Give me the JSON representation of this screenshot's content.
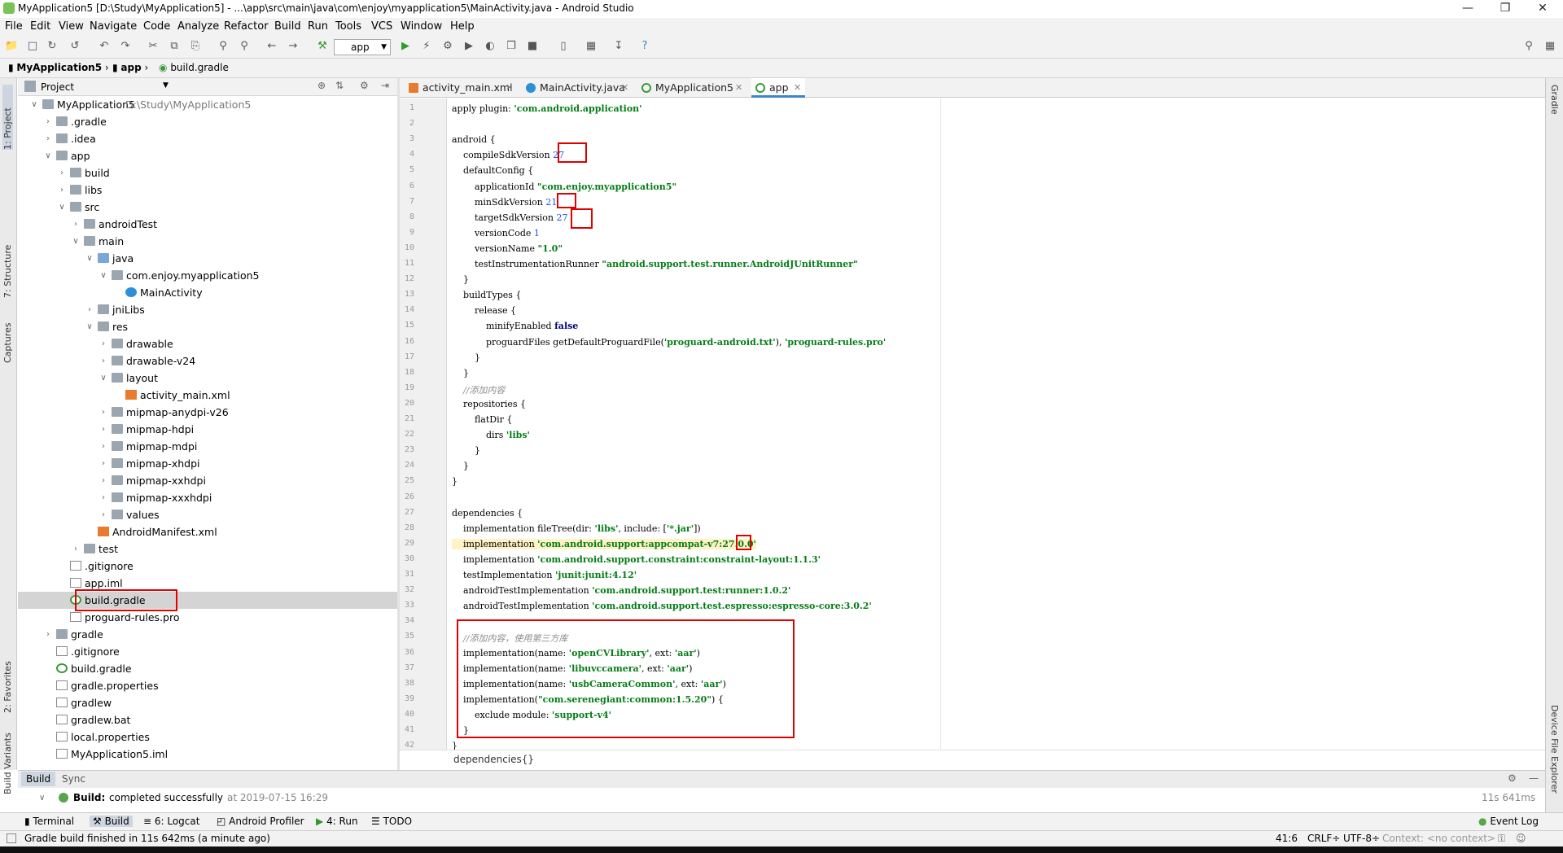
{
  "window": {
    "title": "MyApplication5 [D:\\Study\\MyApplication5] - ...\\app\\src\\main\\java\\com\\enjoy\\myapplication5\\MainActivity.java - Android Studio"
  },
  "menu": [
    "File",
    "Edit",
    "View",
    "Navigate",
    "Code",
    "Analyze",
    "Refactor",
    "Build",
    "Run",
    "Tools",
    "VCS",
    "Window",
    "Help"
  ],
  "toolbar": {
    "run_config": "app"
  },
  "navbar": {
    "crumbs": [
      "MyApplication5",
      "app",
      "build.gradle"
    ]
  },
  "left_strip": {
    "project": "1: Project",
    "structure": "7: Structure",
    "captures": "Captures",
    "favorites": "2: Favorites",
    "build_variants": "Build Variants"
  },
  "right_strip": {
    "gradle": "Gradle",
    "device_explorer": "Device File Explorer"
  },
  "project_panel": {
    "view_mode": "Project",
    "tree": [
      {
        "label": "MyApplication5",
        "sub": "D:\\Study\\MyApplication5"
      },
      {
        "label": ".gradle"
      },
      {
        "label": ".idea"
      },
      {
        "label": "app"
      },
      {
        "label": "build"
      },
      {
        "label": "libs"
      },
      {
        "label": "src"
      },
      {
        "label": "androidTest"
      },
      {
        "label": "main"
      },
      {
        "label": "java"
      },
      {
        "label": "com.enjoy.myapplication5"
      },
      {
        "label": "MainActivity"
      },
      {
        "label": "jniLibs"
      },
      {
        "label": "res"
      },
      {
        "label": "drawable"
      },
      {
        "label": "drawable-v24"
      },
      {
        "label": "layout"
      },
      {
        "label": "activity_main.xml"
      },
      {
        "label": "mipmap-anydpi-v26"
      },
      {
        "label": "mipmap-hdpi"
      },
      {
        "label": "mipmap-mdpi"
      },
      {
        "label": "mipmap-xhdpi"
      },
      {
        "label": "mipmap-xxhdpi"
      },
      {
        "label": "mipmap-xxxhdpi"
      },
      {
        "label": "values"
      },
      {
        "label": "AndroidManifest.xml"
      },
      {
        "label": "test"
      },
      {
        "label": ".gitignore"
      },
      {
        "label": "app.iml"
      },
      {
        "label": "build.gradle"
      },
      {
        "label": "proguard-rules.pro"
      },
      {
        "label": "gradle"
      },
      {
        "label": ".gitignore"
      },
      {
        "label": "build.gradle"
      },
      {
        "label": "gradle.properties"
      },
      {
        "label": "gradlew"
      },
      {
        "label": "gradlew.bat"
      },
      {
        "label": "local.properties"
      },
      {
        "label": "MyApplication5.iml"
      }
    ]
  },
  "tabs": [
    {
      "label": "activity_main.xml"
    },
    {
      "label": "MainActivity.java"
    },
    {
      "label": "MyApplication5"
    },
    {
      "label": "app"
    }
  ],
  "code_lines": [
    "apply plugin: 'com.android.application'",
    "",
    "android {",
    "    compileSdkVersion 27",
    "    defaultConfig {",
    "        applicationId \"com.enjoy.myapplication5\"",
    "        minSdkVersion 21",
    "        targetSdkVersion 27",
    "        versionCode 1",
    "        versionName \"1.0\"",
    "        testInstrumentationRunner \"android.support.test.runner.AndroidJUnitRunner\"",
    "    }",
    "    buildTypes {",
    "        release {",
    "            minifyEnabled false",
    "            proguardFiles getDefaultProguardFile('proguard-android.txt'), 'proguard-rules.pro'",
    "        }",
    "    }",
    "    //添加内容",
    "    repositories {",
    "        flatDir {",
    "            dirs 'libs'",
    "        }",
    "    }",
    "}",
    "",
    "dependencies {",
    "    implementation fileTree(dir: 'libs', include: ['*.jar'])",
    "    implementation 'com.android.support:appcompat-v7:27.0.0'",
    "    implementation 'com.android.support.constraint:constraint-layout:1.1.3'",
    "    testImplementation 'junit:junit:4.12'",
    "    androidTestImplementation 'com.android.support.test:runner:1.0.2'",
    "    androidTestImplementation 'com.android.support.test.espresso:espresso-core:3.0.2'",
    "",
    "    //添加内容，使用第三方库",
    "    implementation(name: 'openCVLibrary', ext: 'aar')",
    "    implementation(name: 'libuvccamera', ext: 'aar')",
    "    implementation(name: 'usbCameraCommon', ext: 'aar')",
    "    implementation(\"com.serenegiant:common:1.5.20\") {",
    "        exclude module: 'support-v4'",
    "    }",
    "}"
  ],
  "editor_crumb": "dependencies{}",
  "build_panel": {
    "tabs": [
      "Build",
      "Sync"
    ],
    "status_label": "Build:",
    "status_text": "completed successfully",
    "timestamp": "at 2019-07-15 16:29",
    "duration": "11s 641ms"
  },
  "bottom_tools": {
    "terminal": "Terminal",
    "build": "Build",
    "logcat": "6: Logcat",
    "profiler": "Android Profiler",
    "run": "4: Run",
    "todo": "TODO",
    "event_log": "Event Log"
  },
  "status_bar": {
    "message": "Gradle build finished in 11s 642ms (a minute ago)",
    "position": "41:6",
    "line_sep": "CRLF÷",
    "encoding": "UTF-8÷",
    "context": "Context: <no context>"
  }
}
